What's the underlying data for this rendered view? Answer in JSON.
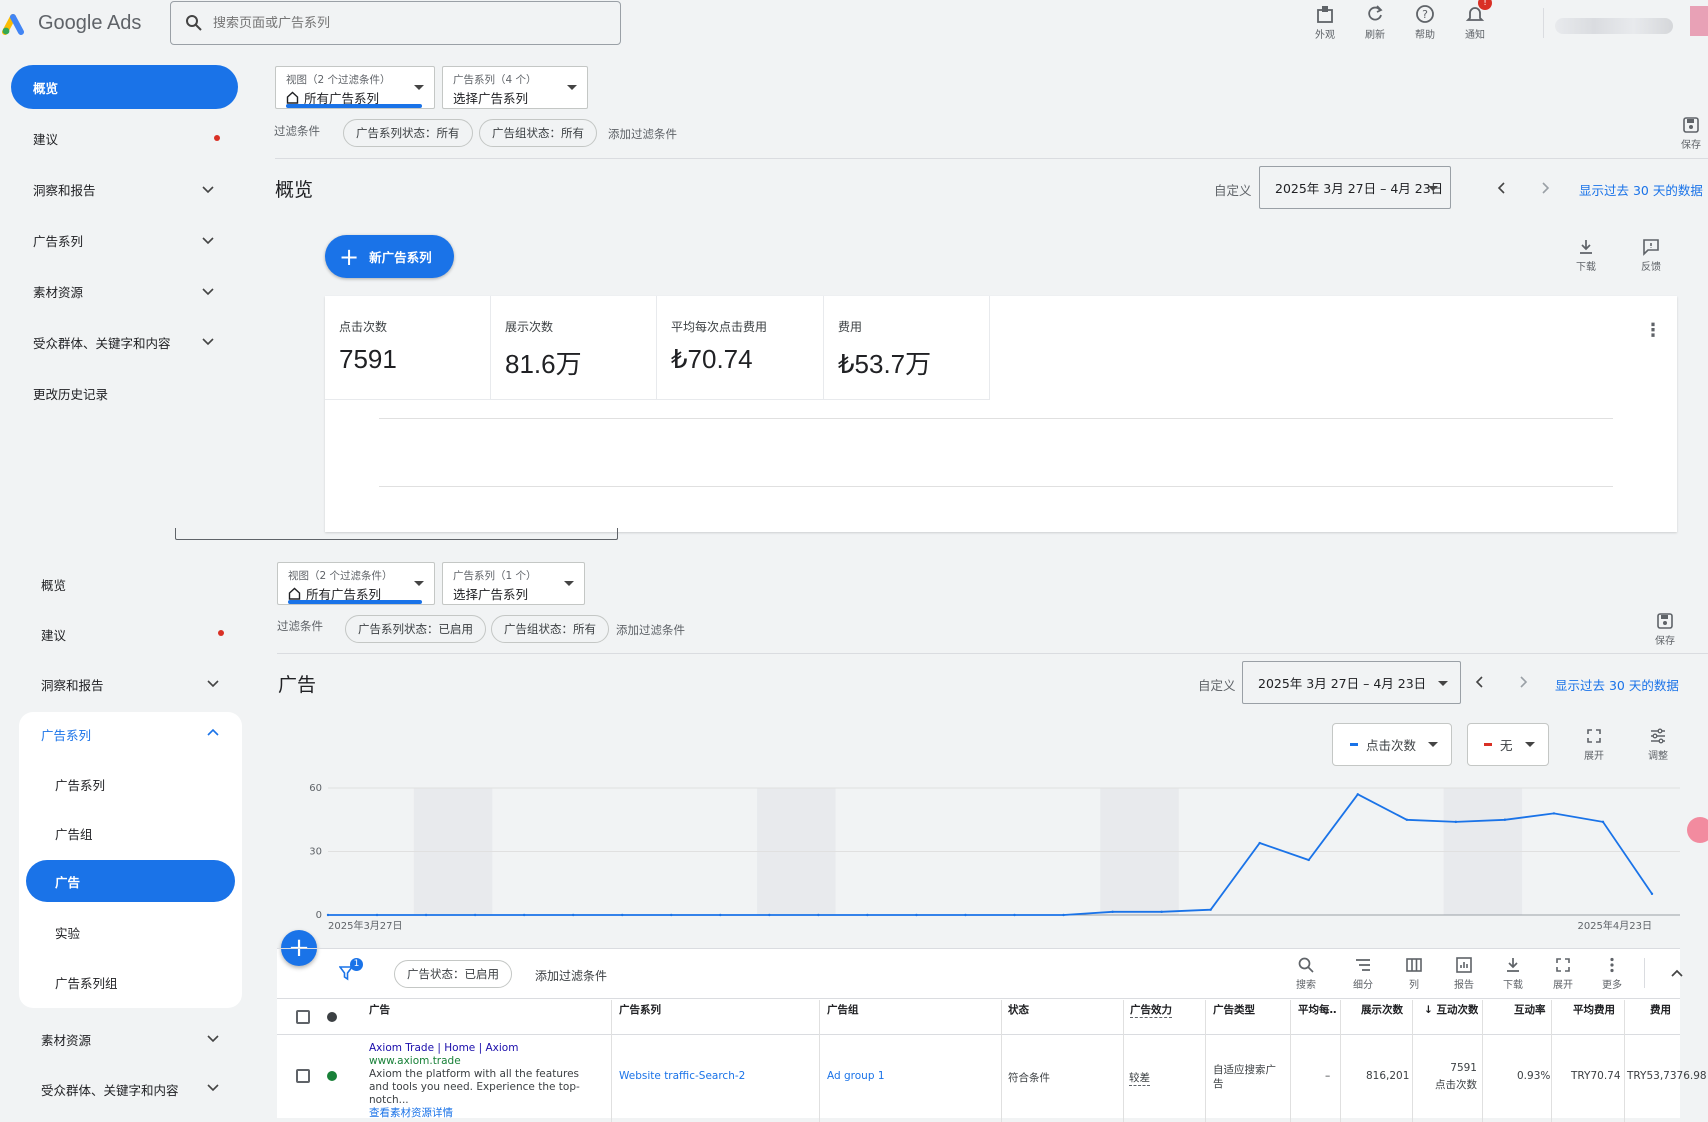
{
  "app": {
    "name": "Google Ads"
  },
  "search": {
    "placeholder": "搜索页面或广告系列"
  },
  "top_actions": [
    {
      "label": "外观",
      "icon": "appearance-icon"
    },
    {
      "label": "刷新",
      "icon": "refresh-icon"
    },
    {
      "label": "帮助",
      "icon": "help-icon"
    },
    {
      "label": "通知",
      "icon": "bell-icon",
      "badge": "!"
    }
  ],
  "sidebar_top": {
    "items": [
      "概览",
      "建议",
      "洞察和报告",
      "广告系列",
      "素材资源",
      "受众群体、关键字和内容",
      "更改历史记录"
    ],
    "active": "概览"
  },
  "sidebar_bottom": {
    "items": [
      "概览",
      "建议",
      "洞察和报告",
      "广告系列",
      "广告系列",
      "广告组",
      "广告",
      "实验",
      "广告系列组",
      "素材资源",
      "受众群体、关键字和内容"
    ],
    "active": "广告"
  },
  "top_panel": {
    "view_sub": "视图（2 个过滤条件）",
    "view_main": "所有广告系列",
    "campaign_sub": "广告系列（4 个）",
    "campaign_main": "选择广告系列",
    "filter_label": "过滤条件",
    "chip1": "广告系列状态：所有",
    "chip2": "广告组状态：所有",
    "add_filter": "添加过滤条件",
    "save": "保存",
    "title": "概览",
    "custom": "自定义",
    "date_range": "2025年 3月 27日 – 4月 23日",
    "last30": "显示过去 30 天的数据",
    "new_campaign": "新广告系列",
    "download": "下载",
    "feedback": "反馈",
    "metrics": [
      {
        "label": "点击次数",
        "value": "7591"
      },
      {
        "label": "展示次数",
        "value": "81.6万"
      },
      {
        "label": "平均每次点击费用",
        "value": "₺70.74"
      },
      {
        "label": "费用",
        "value": "₺53.7万"
      }
    ]
  },
  "bottom_panel": {
    "view_sub": "视图（2 个过滤条件）",
    "view_main": "所有广告系列",
    "campaign_sub": "广告系列（1 个）",
    "campaign_main": "选择广告系列",
    "filter_label": "过滤条件",
    "chip1": "广告系列状态：已启用",
    "chip2": "广告组状态：所有",
    "add_filter": "添加过滤条件",
    "save": "保存",
    "title": "广告",
    "custom": "自定义",
    "date_range": "2025年 3月 27日 – 4月 23日",
    "last30": "显示过去 30 天的数据",
    "metric1": "点击次数",
    "metric1_color": "#1a73e8",
    "metric2": "无",
    "metric2_color": "#d93025",
    "expand": "展开",
    "adjust": "调整"
  },
  "chart_data": {
    "type": "line",
    "x_start_label": "2025年3月27日",
    "x_end_label": "2025年4月23日",
    "yticks": [
      "0",
      "30",
      "60"
    ],
    "ylim": [
      0,
      60
    ],
    "series": [
      {
        "name": "点击次数",
        "color": "#1a73e8",
        "values": [
          0,
          0,
          0,
          0,
          0,
          0,
          0,
          0,
          0,
          0,
          0,
          0,
          0,
          0,
          0,
          0,
          1.5,
          1.5,
          2.5,
          34,
          26,
          57,
          45,
          44,
          45,
          48,
          44,
          10
        ]
      }
    ],
    "weekend_bands": [
      2,
      9,
      16,
      23
    ]
  },
  "table": {
    "filter_badge": "1",
    "status_chip": "广告状态：已启用",
    "add_filter": "添加过滤条件",
    "tools": [
      "搜索",
      "细分",
      "列",
      "报告",
      "下载",
      "展开",
      "更多"
    ],
    "columns": [
      "广告",
      "广告系列",
      "广告组",
      "状态",
      "广告效力",
      "广告类型",
      "平均每…",
      "展示次数",
      "互动次数",
      "互动率",
      "平均费用",
      "费用"
    ],
    "row": {
      "ad_title": "Axiom Trade | Home | Axiom",
      "ad_url": "www.axiom.trade",
      "ad_desc": "Axiom the platform with all the features and tools you need. Experience the top-notch...",
      "ad_more": "查看素材资源详情",
      "campaign": "Website traffic-Search-2",
      "ad_group": "Ad group 1",
      "status": "符合条件",
      "strength": "较差",
      "ad_type": "自适应搜索广告",
      "avg_cpc": "–",
      "impressions": "816,201",
      "interactions": "7591",
      "interactions_sub": "点击次数",
      "interaction_rate": "0.93%",
      "avg_cost": "TRY70.74",
      "cost": "TRY53,7376.98"
    }
  }
}
